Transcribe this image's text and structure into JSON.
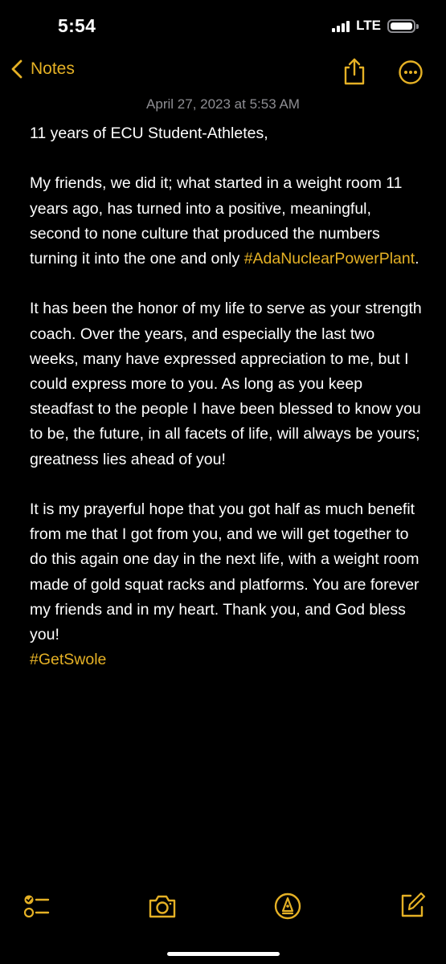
{
  "status_bar": {
    "time": "5:54",
    "network": "LTE"
  },
  "nav": {
    "back_label": "Notes",
    "back_icon": "chevron-left-icon",
    "share_icon": "share-icon",
    "more_icon": "more-icon"
  },
  "note": {
    "date": "April 27, 2023 at 5:53 AM",
    "line1": "11 years of ECU Student-Athletes,",
    "para1_text": "My friends, we did it; what started in a weight room 11 years ago, has turned into a positive, meaningful, second to none culture that produced the numbers turning it into the one and only ",
    "para1_tag": "#AdaNuclearPowerPlant",
    "para1_end": ".",
    "para2": "It has been the honor of my life to serve as your strength coach. Over the years, and especially the last two weeks, many have expressed appreciation to me, but I could express more to you. As long as you keep steadfast to the people I have been blessed to know you to be, the future, in all facets of life, will always be yours; greatness lies ahead of you!",
    "para3": "It is my prayerful hope that you got half as much benefit from me that I got from you, and we will get together to do this again one day in the next life, with a weight room made of gold squat racks and platforms. You are forever my friends and in my heart. Thank you, and God bless you!",
    "closing_tag": "#GetSwole"
  },
  "toolbar": {
    "items": [
      "checklist-icon",
      "camera-icon",
      "markup-icon",
      "compose-icon"
    ]
  },
  "colors": {
    "accent": "#e5b125",
    "background": "#000000",
    "text": "#ffffff",
    "secondary": "#8e8e93"
  }
}
